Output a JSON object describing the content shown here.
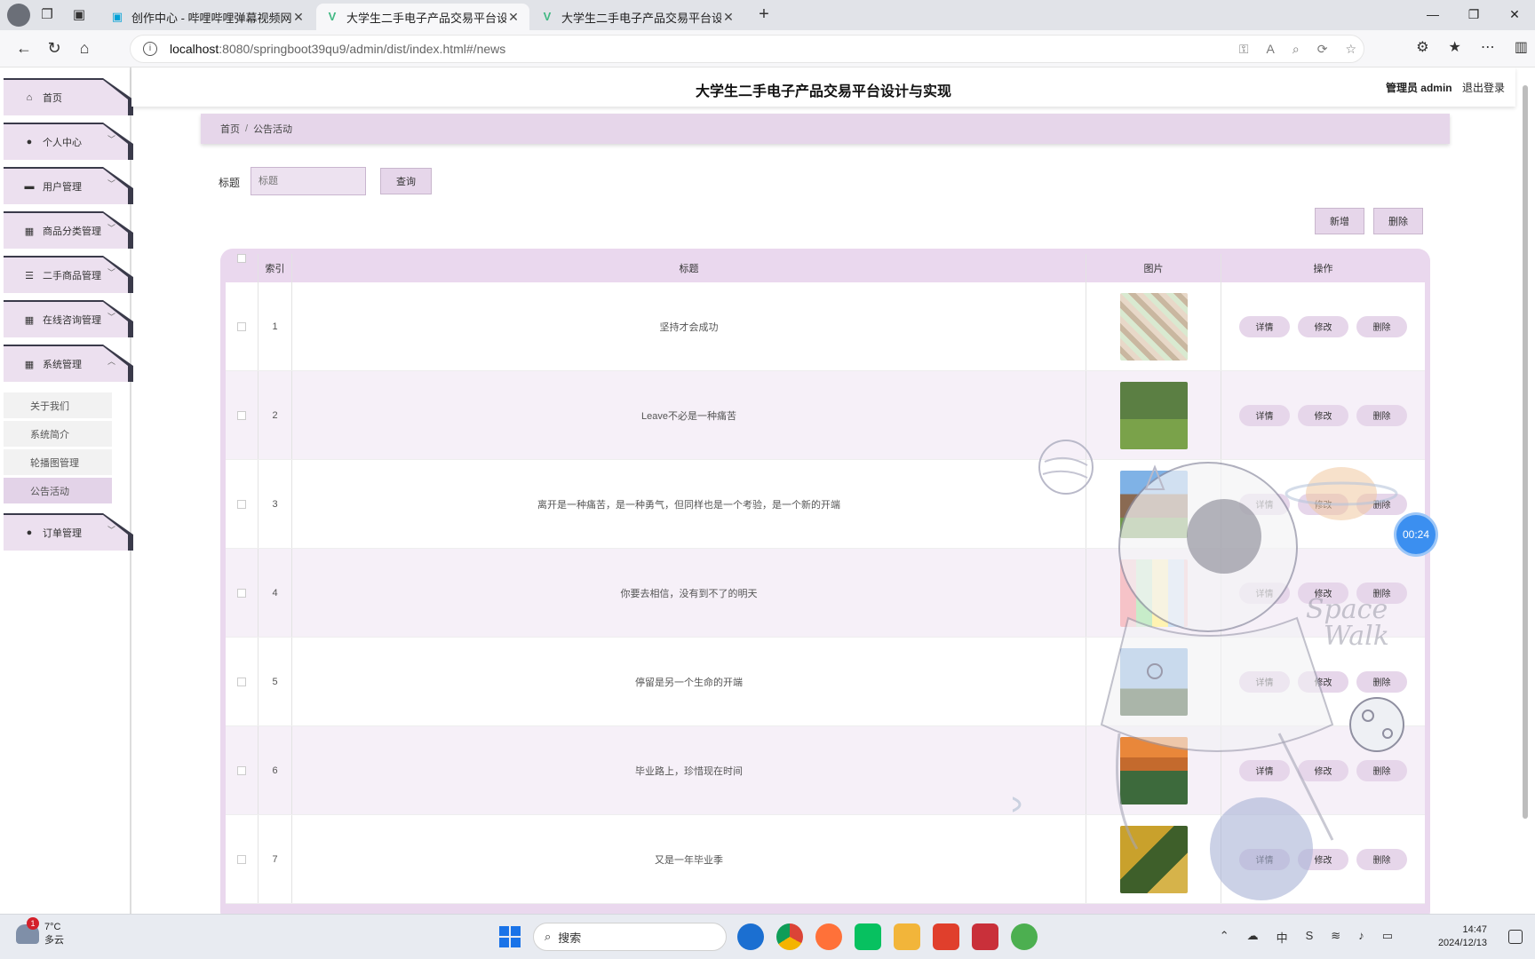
{
  "browser": {
    "tabs": [
      {
        "title": "创作中心 - 哔哩哔哩弹幕视频网",
        "icon": "bilibili-icon",
        "active": false
      },
      {
        "title": "大学生二手电子产品交易平台设计",
        "icon": "vue-icon",
        "active": true
      },
      {
        "title": "大学生二手电子产品交易平台设计",
        "icon": "vue-icon",
        "active": false
      }
    ],
    "url_host": "localhost",
    "url_path": ":8080/springboot39qu9/admin/dist/index.html#/news"
  },
  "header": {
    "site_title": "大学生二手电子产品交易平台设计与实现",
    "user_role": "管理员 admin",
    "logout": "退出登录"
  },
  "sidebar": {
    "items": [
      {
        "label": "首页",
        "icon": "home-icon",
        "expandable": false
      },
      {
        "label": "个人中心",
        "icon": "user-icon",
        "expandable": true
      },
      {
        "label": "用户管理",
        "icon": "lock-icon",
        "expandable": true
      },
      {
        "label": "商品分类管理",
        "icon": "grid-icon",
        "expandable": true
      },
      {
        "label": "二手商品管理",
        "icon": "list-icon",
        "expandable": true
      },
      {
        "label": "在线咨询管理",
        "icon": "grid-icon",
        "expandable": true
      },
      {
        "label": "系统管理",
        "icon": "grid-icon",
        "expandable": true,
        "expanded": true
      },
      {
        "label": "订单管理",
        "icon": "user-icon",
        "expandable": true
      }
    ],
    "sub_items": [
      {
        "label": "关于我们",
        "active": false
      },
      {
        "label": "系统简介",
        "active": false
      },
      {
        "label": "轮播图管理",
        "active": false
      },
      {
        "label": "公告活动",
        "active": true
      }
    ]
  },
  "breadcrumb": {
    "home": "首页",
    "separator": "/",
    "current": "公告活动"
  },
  "search": {
    "label": "标题",
    "placeholder": "标题",
    "query_button": "查询"
  },
  "actions": {
    "add": "新增",
    "delete": "删除"
  },
  "table": {
    "columns": {
      "index": "索引",
      "title": "标题",
      "image": "图片",
      "actions": "操作"
    },
    "row_actions": {
      "detail": "详情",
      "edit": "修改",
      "delete": "删除"
    },
    "rows": [
      {
        "index": "1",
        "title": "坚持才会成功",
        "thumb": "map-collage"
      },
      {
        "index": "2",
        "title": "Leave不必是一种痛苦",
        "thumb": "campus-lawn"
      },
      {
        "index": "3",
        "title": "离开是一种痛苦，是一种勇气，但同样也是一个考验，是一个新的开端",
        "thumb": "campus-building"
      },
      {
        "index": "4",
        "title": "你要去相信，没有到不了的明天",
        "thumb": "icon-grid"
      },
      {
        "index": "5",
        "title": "停留是另一个生命的开端",
        "thumb": "statue"
      },
      {
        "index": "6",
        "title": "毕业路上，珍惜现在时间",
        "thumb": "sunset-campus"
      },
      {
        "index": "7",
        "title": "又是一年毕业季",
        "thumb": "autumn-path"
      }
    ]
  },
  "timer": "00:24",
  "taskbar": {
    "weather_temp": "7°C",
    "weather_desc": "多云",
    "weather_badge": "1",
    "search_placeholder": "搜索",
    "time": "14:47",
    "date": "2024/12/13"
  }
}
